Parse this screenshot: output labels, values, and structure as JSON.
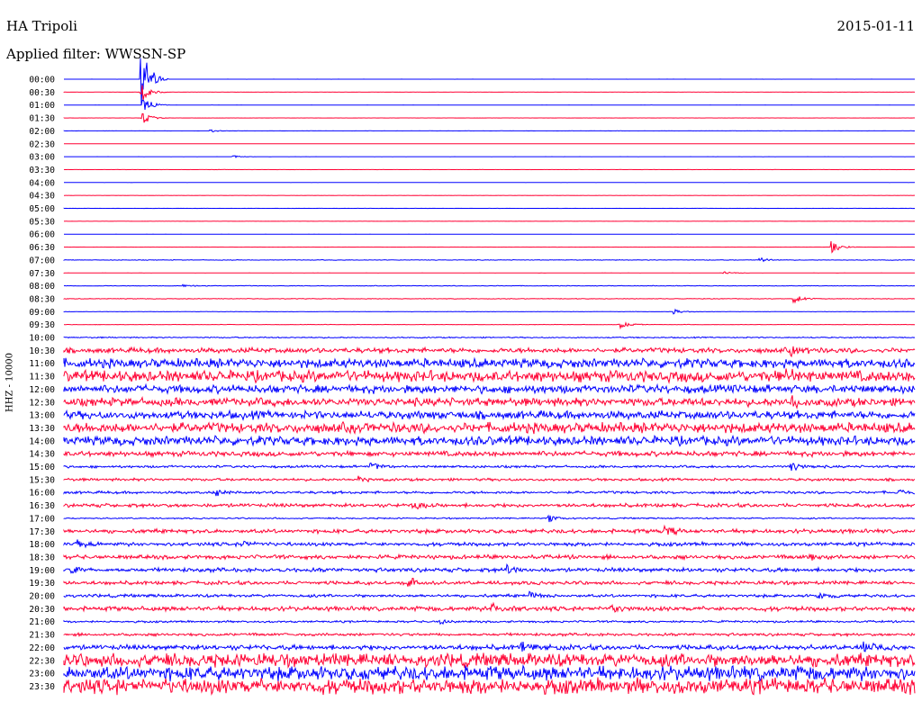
{
  "header": {
    "station": "HA Tripoli",
    "date": "2015-01-11",
    "filter": "Applied filter: WWSSN-SP"
  },
  "chart_data": {
    "type": "line",
    "title": "HA Tripoli",
    "ylabel": "HHZ - 10000",
    "trace_colors": [
      "#0000ff",
      "#ff0033"
    ],
    "rows": [
      {
        "label": "00:00",
        "amp": 0.05,
        "events": [
          [
            158,
            40
          ]
        ]
      },
      {
        "label": "00:30",
        "amp": 0.08,
        "events": [
          [
            158,
            12
          ]
        ]
      },
      {
        "label": "01:00",
        "amp": 0.05,
        "events": [
          [
            160,
            10
          ]
        ]
      },
      {
        "label": "01:30",
        "amp": 0.05,
        "events": [
          [
            159,
            8
          ]
        ]
      },
      {
        "label": "02:00",
        "amp": 0.08,
        "events": [
          [
            235,
            1.5
          ]
        ]
      },
      {
        "label": "02:30",
        "amp": 0.05,
        "events": []
      },
      {
        "label": "03:00",
        "amp": 0.05,
        "events": [
          [
            260,
            1.5
          ]
        ]
      },
      {
        "label": "03:30",
        "amp": 0.1,
        "events": []
      },
      {
        "label": "04:00",
        "amp": 0.05,
        "events": []
      },
      {
        "label": "04:30",
        "amp": 0.05,
        "events": []
      },
      {
        "label": "05:00",
        "amp": 0.1,
        "events": []
      },
      {
        "label": "05:30",
        "amp": 0.05,
        "events": []
      },
      {
        "label": "06:00",
        "amp": 0.05,
        "events": []
      },
      {
        "label": "06:30",
        "amp": 0.08,
        "events": [
          [
            925,
            9
          ]
        ]
      },
      {
        "label": "07:00",
        "amp": 0.3,
        "events": [
          [
            845,
            3
          ]
        ]
      },
      {
        "label": "07:30",
        "amp": 0.1,
        "events": [
          [
            805,
            2
          ]
        ]
      },
      {
        "label": "08:00",
        "amp": 0.3,
        "events": [
          [
            205,
            2
          ]
        ]
      },
      {
        "label": "08:30",
        "amp": 0.3,
        "events": [
          [
            883,
            6
          ]
        ]
      },
      {
        "label": "09:00",
        "amp": 0.2,
        "events": [
          [
            750,
            3
          ]
        ]
      },
      {
        "label": "09:30",
        "amp": 0.2,
        "events": [
          [
            690,
            5
          ]
        ]
      },
      {
        "label": "10:00",
        "amp": 0.6,
        "events": []
      },
      {
        "label": "10:30",
        "amp": 2.5,
        "events": [
          [
            880,
            5
          ]
        ]
      },
      {
        "label": "11:00",
        "amp": 4.5,
        "events": []
      },
      {
        "label": "11:30",
        "amp": 5.5,
        "events": [
          [
            875,
            6
          ]
        ]
      },
      {
        "label": "12:00",
        "amp": 4.0,
        "events": []
      },
      {
        "label": "12:30",
        "amp": 4.0,
        "events": [
          [
            880,
            6
          ]
        ]
      },
      {
        "label": "13:00",
        "amp": 4.0,
        "events": []
      },
      {
        "label": "13:30",
        "amp": 5.0,
        "events": []
      },
      {
        "label": "14:00",
        "amp": 4.5,
        "events": []
      },
      {
        "label": "14:30",
        "amp": 2.5,
        "events": []
      },
      {
        "label": "15:00",
        "amp": 1.2,
        "events": [
          [
            413,
            6
          ],
          [
            880,
            6
          ]
        ]
      },
      {
        "label": "15:30",
        "amp": 1.3,
        "events": [
          [
            400,
            3
          ]
        ]
      },
      {
        "label": "16:00",
        "amp": 1.3,
        "events": [
          [
            242,
            4
          ],
          [
            1000,
            4
          ]
        ]
      },
      {
        "label": "16:30",
        "amp": 1.8,
        "events": [
          [
            460,
            4
          ]
        ]
      },
      {
        "label": "17:00",
        "amp": 0.7,
        "events": [
          [
            610,
            4
          ]
        ]
      },
      {
        "label": "17:30",
        "amp": 2.0,
        "events": [
          [
            740,
            5
          ]
        ]
      },
      {
        "label": "18:00",
        "amp": 1.8,
        "events": [
          [
            85,
            5
          ],
          [
            270,
            4
          ]
        ]
      },
      {
        "label": "18:30",
        "amp": 2.0,
        "events": [
          [
            900,
            4
          ]
        ]
      },
      {
        "label": "19:00",
        "amp": 2.0,
        "events": [
          [
            80,
            4
          ],
          [
            565,
            4
          ]
        ]
      },
      {
        "label": "19:30",
        "amp": 1.8,
        "events": [
          [
            455,
            8
          ]
        ]
      },
      {
        "label": "20:00",
        "amp": 1.5,
        "events": [
          [
            590,
            4
          ],
          [
            910,
            4
          ]
        ]
      },
      {
        "label": "20:30",
        "amp": 2.2,
        "events": [
          [
            548,
            5
          ],
          [
            680,
            5
          ]
        ]
      },
      {
        "label": "21:00",
        "amp": 1.0,
        "events": [
          [
            490,
            3
          ]
        ]
      },
      {
        "label": "21:30",
        "amp": 1.4,
        "events": []
      },
      {
        "label": "22:00",
        "amp": 2.5,
        "events": [
          [
            580,
            5
          ],
          [
            960,
            5
          ]
        ]
      },
      {
        "label": "22:30",
        "amp": 6.5,
        "events": []
      },
      {
        "label": "23:00",
        "amp": 7.0,
        "events": []
      },
      {
        "label": "23:30",
        "amp": 7.5,
        "events": []
      }
    ]
  }
}
